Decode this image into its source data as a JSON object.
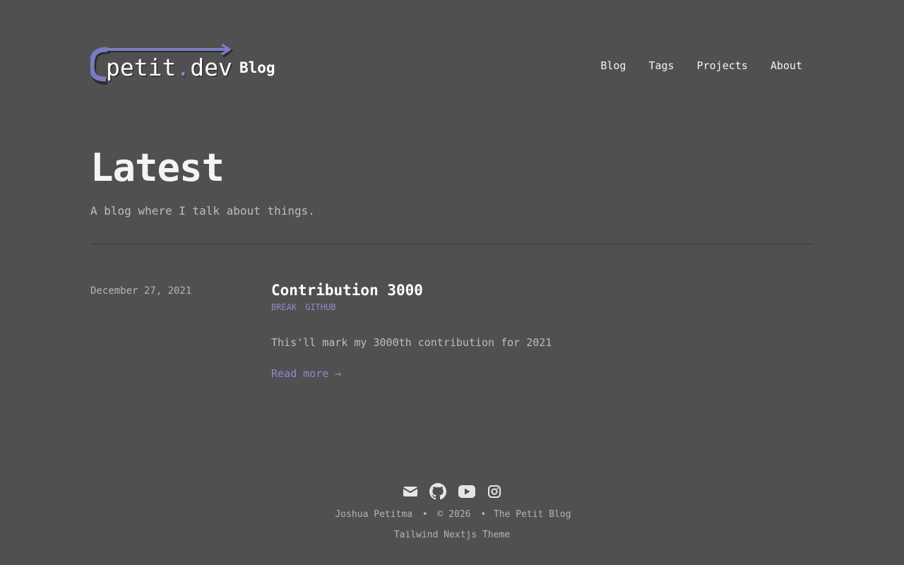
{
  "header": {
    "logo_text": "petit.dev",
    "site_title": "Blog",
    "nav": [
      {
        "label": "Blog"
      },
      {
        "label": "Tags"
      },
      {
        "label": "Projects"
      },
      {
        "label": "About"
      }
    ]
  },
  "hero": {
    "title": "Latest",
    "subtitle": "A blog where I talk about things."
  },
  "posts": [
    {
      "date": "December 27, 2021",
      "title": "Contribution 3000",
      "tags": [
        "BREAK",
        "GITHUB"
      ],
      "summary": "This'll mark my 3000th contribution for 2021",
      "read_more": "Read more →"
    }
  ],
  "footer": {
    "socials": [
      "mail-icon",
      "github-icon",
      "youtube-icon",
      "instagram-icon"
    ],
    "author": "Joshua Petitma",
    "separator": "•",
    "copyright": "© 2026",
    "blog_name": "The Petit Blog",
    "theme": "Tailwind Nextjs Theme"
  },
  "colors": {
    "background": "#505050",
    "accent": "#8b8bd1",
    "text": "#ffffff",
    "muted": "#bdbdbd"
  }
}
